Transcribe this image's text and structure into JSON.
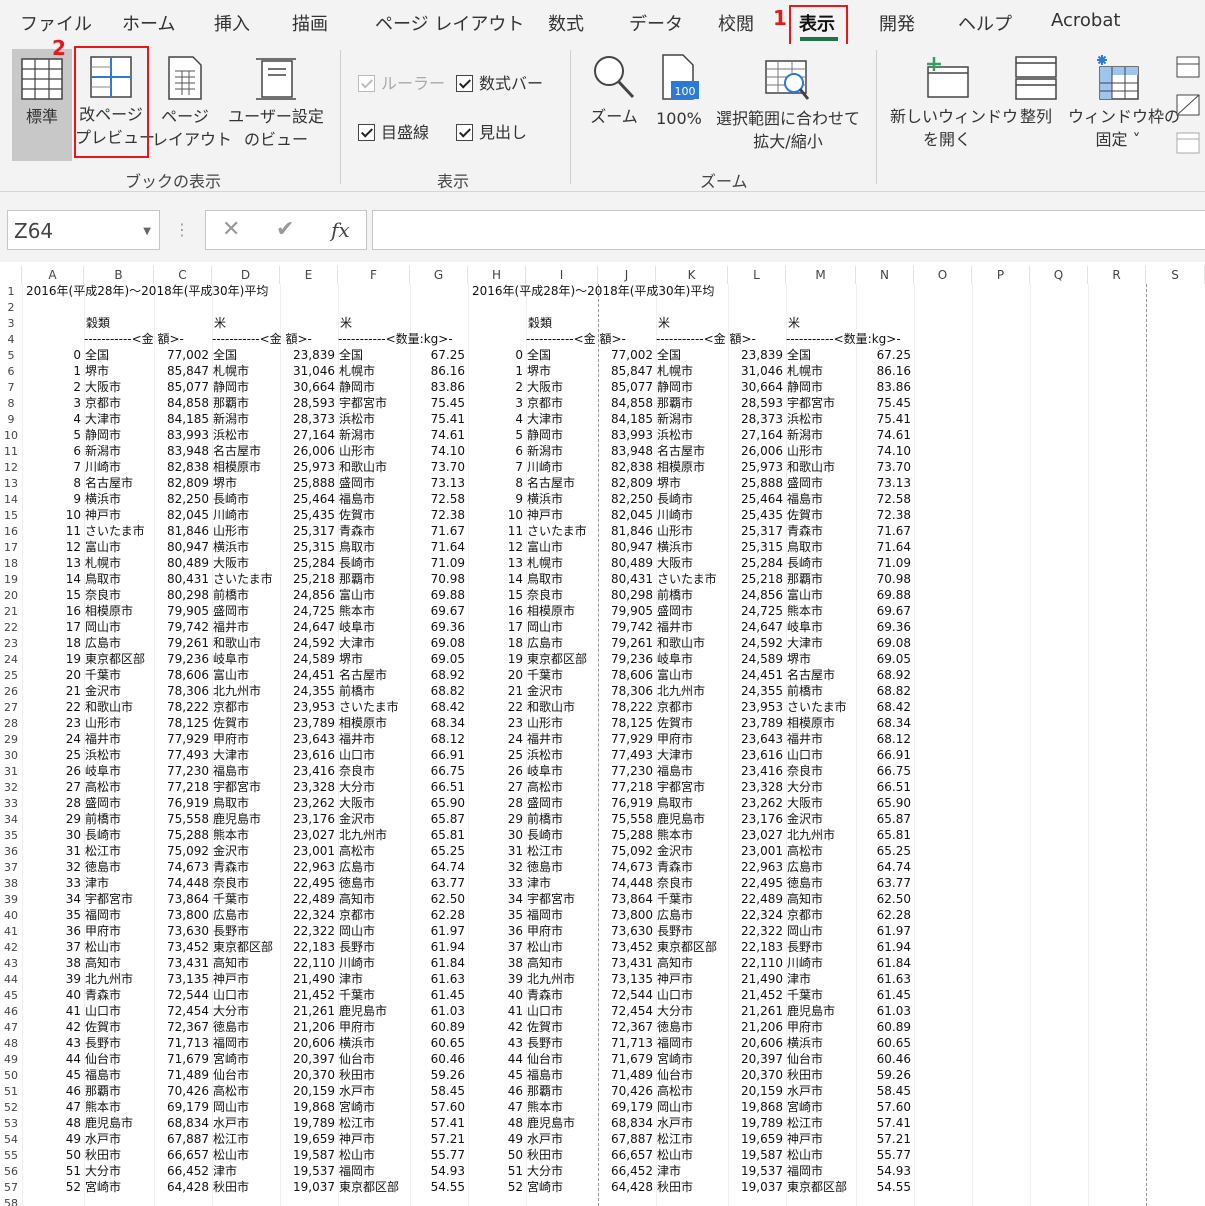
{
  "tabs": [
    {
      "label": "ファイル"
    },
    {
      "label": "ホーム"
    },
    {
      "label": "挿入"
    },
    {
      "label": "描画"
    },
    {
      "label": "ページ レイアウト"
    },
    {
      "label": "数式"
    },
    {
      "label": "データ"
    },
    {
      "label": "校閲"
    },
    {
      "label": "表示"
    },
    {
      "label": "開発"
    },
    {
      "label": "ヘルプ"
    },
    {
      "label": "Acrobat"
    }
  ],
  "badges": {
    "one": "1",
    "two": "2"
  },
  "ribbon": {
    "normal": "標準",
    "page_break_1": "改ページ",
    "page_break_2": "プレビュー",
    "page_layout_1": "ページ",
    "page_layout_2": "レイアウト",
    "custom_view_1": "ユーザー設定",
    "custom_view_2": "のビュー",
    "group_book": "ブックの表示",
    "ruler": "ルーラー",
    "formula_bar": "数式バー",
    "gridlines": "目盛線",
    "headings": "見出し",
    "group_show": "表示",
    "zoom": "ズーム",
    "zoom100": "100%",
    "zoom_sel_1": "選択範囲に合わせて",
    "zoom_sel_2": "拡大/縮小",
    "group_zoom": "ズーム",
    "new_window_1": "新しいウィンドウ",
    "new_window_2": "を開く",
    "arrange": "整列",
    "freeze_1": "ウィンドウ枠の",
    "freeze_2": "固定 ˅",
    "icon_100": "100"
  },
  "formula_bar": {
    "name_box": "Z64",
    "fx": "fx",
    "cancel": "✕",
    "enter": "✔"
  },
  "sheet": {
    "columns": [
      "A",
      "B",
      "C",
      "D",
      "E",
      "F",
      "G",
      "H",
      "I",
      "J",
      "K",
      "L",
      "M",
      "N",
      "O",
      "P",
      "Q",
      "R",
      "S"
    ],
    "title": "2016年(平成28年)～2018年(平成30年)平均",
    "hdr_grain": "穀類",
    "hdr_rice": "米",
    "hdr_amount": "-----------<金 額>-",
    "hdr_qty": "-----------<数量:kg>-",
    "rows": [
      [
        0,
        "全国",
        "77,002",
        "全国",
        "23,839",
        "全国",
        "67.25"
      ],
      [
        1,
        "堺市",
        "85,847",
        "札幌市",
        "31,046",
        "札幌市",
        "86.16"
      ],
      [
        2,
        "大阪市",
        "85,077",
        "静岡市",
        "30,664",
        "静岡市",
        "83.86"
      ],
      [
        3,
        "京都市",
        "84,858",
        "那覇市",
        "28,593",
        "宇都宮市",
        "75.45"
      ],
      [
        4,
        "大津市",
        "84,185",
        "新潟市",
        "28,373",
        "浜松市",
        "75.41"
      ],
      [
        5,
        "静岡市",
        "83,993",
        "浜松市",
        "27,164",
        "新潟市",
        "74.61"
      ],
      [
        6,
        "新潟市",
        "83,948",
        "名古屋市",
        "26,006",
        "山形市",
        "74.10"
      ],
      [
        7,
        "川崎市",
        "82,838",
        "相模原市",
        "25,973",
        "和歌山市",
        "73.70"
      ],
      [
        8,
        "名古屋市",
        "82,809",
        "堺市",
        "25,888",
        "盛岡市",
        "73.13"
      ],
      [
        9,
        "横浜市",
        "82,250",
        "長崎市",
        "25,464",
        "福島市",
        "72.58"
      ],
      [
        10,
        "神戸市",
        "82,045",
        "川崎市",
        "25,435",
        "佐賀市",
        "72.38"
      ],
      [
        11,
        "さいたま市",
        "81,846",
        "山形市",
        "25,317",
        "青森市",
        "71.67"
      ],
      [
        12,
        "富山市",
        "80,947",
        "横浜市",
        "25,315",
        "鳥取市",
        "71.64"
      ],
      [
        13,
        "札幌市",
        "80,489",
        "大阪市",
        "25,284",
        "長崎市",
        "71.09"
      ],
      [
        14,
        "鳥取市",
        "80,431",
        "さいたま市",
        "25,218",
        "那覇市",
        "70.98"
      ],
      [
        15,
        "奈良市",
        "80,298",
        "前橋市",
        "24,856",
        "富山市",
        "69.88"
      ],
      [
        16,
        "相模原市",
        "79,905",
        "盛岡市",
        "24,725",
        "熊本市",
        "69.67"
      ],
      [
        17,
        "岡山市",
        "79,742",
        "福井市",
        "24,647",
        "岐阜市",
        "69.36"
      ],
      [
        18,
        "広島市",
        "79,261",
        "和歌山市",
        "24,592",
        "大津市",
        "69.08"
      ],
      [
        19,
        "東京都区部",
        "79,236",
        "岐阜市",
        "24,589",
        "堺市",
        "69.05"
      ],
      [
        20,
        "千葉市",
        "78,606",
        "富山市",
        "24,451",
        "名古屋市",
        "68.92"
      ],
      [
        21,
        "金沢市",
        "78,306",
        "北九州市",
        "24,355",
        "前橋市",
        "68.82"
      ],
      [
        22,
        "和歌山市",
        "78,222",
        "京都市",
        "23,953",
        "さいたま市",
        "68.42"
      ],
      [
        23,
        "山形市",
        "78,125",
        "佐賀市",
        "23,789",
        "相模原市",
        "68.34"
      ],
      [
        24,
        "福井市",
        "77,929",
        "甲府市",
        "23,643",
        "福井市",
        "68.12"
      ],
      [
        25,
        "浜松市",
        "77,493",
        "大津市",
        "23,616",
        "山口市",
        "66.91"
      ],
      [
        26,
        "岐阜市",
        "77,230",
        "福島市",
        "23,416",
        "奈良市",
        "66.75"
      ],
      [
        27,
        "高松市",
        "77,218",
        "宇都宮市",
        "23,328",
        "大分市",
        "66.51"
      ],
      [
        28,
        "盛岡市",
        "76,919",
        "鳥取市",
        "23,262",
        "大阪市",
        "65.90"
      ],
      [
        29,
        "前橋市",
        "75,558",
        "鹿児島市",
        "23,176",
        "金沢市",
        "65.87"
      ],
      [
        30,
        "長崎市",
        "75,288",
        "熊本市",
        "23,027",
        "北九州市",
        "65.81"
      ],
      [
        31,
        "松江市",
        "75,092",
        "金沢市",
        "23,001",
        "高松市",
        "65.25"
      ],
      [
        32,
        "徳島市",
        "74,673",
        "青森市",
        "22,963",
        "広島市",
        "64.74"
      ],
      [
        33,
        "津市",
        "74,448",
        "奈良市",
        "22,495",
        "徳島市",
        "63.77"
      ],
      [
        34,
        "宇都宮市",
        "73,864",
        "千葉市",
        "22,489",
        "高知市",
        "62.50"
      ],
      [
        35,
        "福岡市",
        "73,800",
        "広島市",
        "22,324",
        "京都市",
        "62.28"
      ],
      [
        36,
        "甲府市",
        "73,630",
        "長野市",
        "22,322",
        "岡山市",
        "61.97"
      ],
      [
        37,
        "松山市",
        "73,452",
        "東京都区部",
        "22,183",
        "長野市",
        "61.94"
      ],
      [
        38,
        "高知市",
        "73,431",
        "高知市",
        "22,110",
        "川崎市",
        "61.84"
      ],
      [
        39,
        "北九州市",
        "73,135",
        "神戸市",
        "21,490",
        "津市",
        "61.63"
      ],
      [
        40,
        "青森市",
        "72,544",
        "山口市",
        "21,452",
        "千葉市",
        "61.45"
      ],
      [
        41,
        "山口市",
        "72,454",
        "大分市",
        "21,261",
        "鹿児島市",
        "61.03"
      ],
      [
        42,
        "佐賀市",
        "72,367",
        "徳島市",
        "21,206",
        "甲府市",
        "60.89"
      ],
      [
        43,
        "長野市",
        "71,713",
        "福岡市",
        "20,606",
        "横浜市",
        "60.65"
      ],
      [
        44,
        "仙台市",
        "71,679",
        "宮崎市",
        "20,397",
        "仙台市",
        "60.46"
      ],
      [
        45,
        "福島市",
        "71,489",
        "仙台市",
        "20,370",
        "秋田市",
        "59.26"
      ],
      [
        46,
        "那覇市",
        "70,426",
        "高松市",
        "20,159",
        "水戸市",
        "58.45"
      ],
      [
        47,
        "熊本市",
        "69,179",
        "岡山市",
        "19,868",
        "宮崎市",
        "57.60"
      ],
      [
        48,
        "鹿児島市",
        "68,834",
        "水戸市",
        "19,789",
        "松江市",
        "57.41"
      ],
      [
        49,
        "水戸市",
        "67,887",
        "松江市",
        "19,659",
        "神戸市",
        "57.21"
      ],
      [
        50,
        "秋田市",
        "66,657",
        "松山市",
        "19,587",
        "松山市",
        "55.77"
      ],
      [
        51,
        "大分市",
        "66,452",
        "津市",
        "19,537",
        "福岡市",
        "54.93"
      ],
      [
        52,
        "宮崎市",
        "64,428",
        "秋田市",
        "19,037",
        "東京都区部",
        "54.55"
      ]
    ]
  }
}
